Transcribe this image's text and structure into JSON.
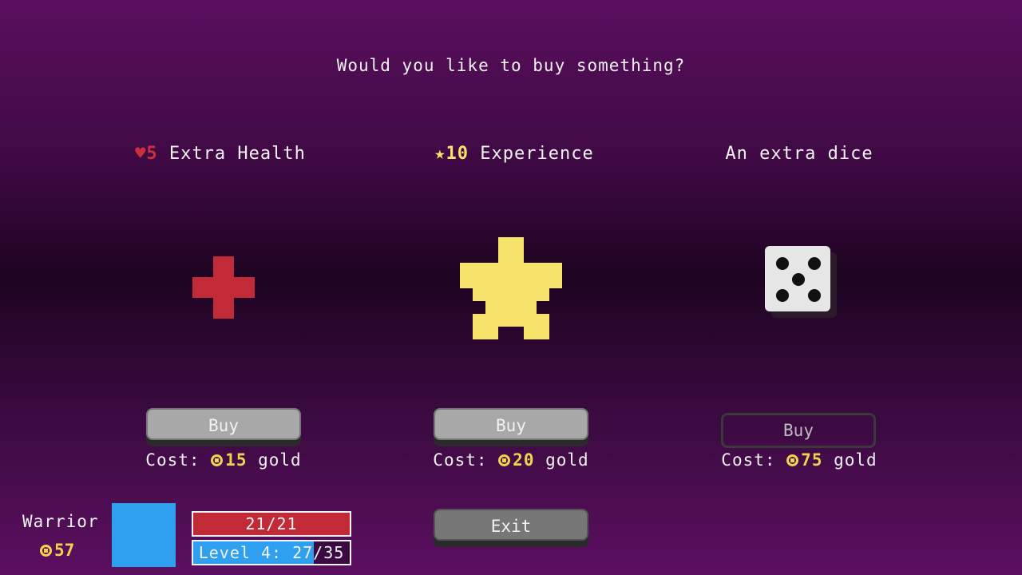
{
  "prompt": "Would you like to buy something?",
  "items": [
    {
      "icon": "heart-icon",
      "amount": "5",
      "label": "Extra Health",
      "art": "red-cross",
      "button_label": "Buy",
      "button_enabled": true,
      "cost_prefix": "Cost:",
      "cost_value": "15",
      "cost_suffix": "gold"
    },
    {
      "icon": "star-icon",
      "amount": "10",
      "label": "Experience",
      "art": "yellow-star",
      "button_label": "Buy",
      "button_enabled": true,
      "cost_prefix": "Cost:",
      "cost_value": "20",
      "cost_suffix": "gold"
    },
    {
      "icon": "",
      "amount": "",
      "label": "An extra dice",
      "art": "white-die-five",
      "button_label": "Buy",
      "button_enabled": false,
      "cost_prefix": "Cost:",
      "cost_value": "75",
      "cost_suffix": "gold"
    }
  ],
  "exit_label": "Exit",
  "player": {
    "name": "Warrior",
    "gold": "57",
    "hp_text": "21/21",
    "hp_fraction": 1.0,
    "level_text": "Level 4: 27/35",
    "xp_fraction": 0.771
  },
  "colors": {
    "health_red": "#c12a36",
    "star_yellow": "#f7e26b",
    "gold": "#f2d34c",
    "portrait_blue": "#2fa0f0"
  }
}
